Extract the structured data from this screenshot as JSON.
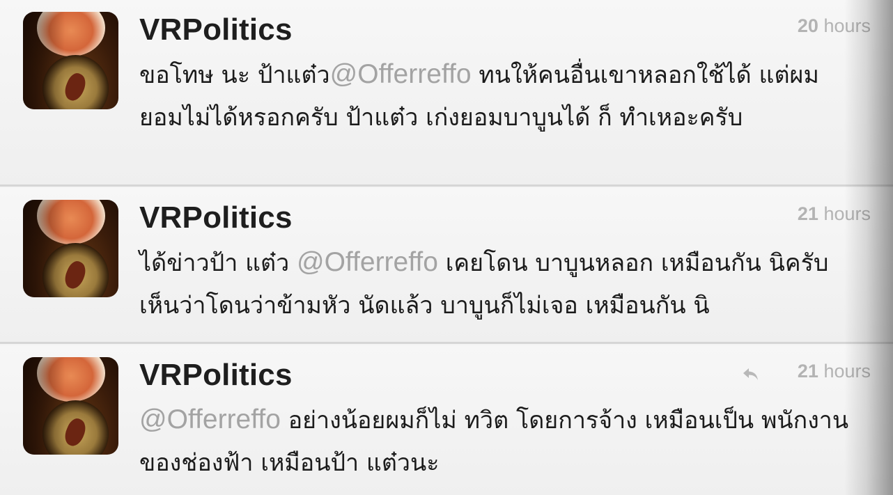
{
  "tweets": [
    {
      "username": "VRPolitics",
      "time_number": "20",
      "time_unit": "hours",
      "has_reply_icon": false,
      "text_before": "ขอโทษ นะ ป้าแต๋ว",
      "mention": "@Offerreffo",
      "text_after": "  ทนให้คนอื่นเขาหลอกใช้ได้ แต่ผม ยอมไม่ได้หรอกครับ ป้าแต๋ว เก่งยอมบาบูนได้ ก็  ทำเหอะครับ"
    },
    {
      "username": "VRPolitics",
      "time_number": "21",
      "time_unit": "hours",
      "has_reply_icon": false,
      "text_before": "ได้ข่าวป้า แต๋ว ",
      "mention": "@Offerreffo",
      "text_after": " เคยโดน บาบูนหลอก เหมือนกัน นิครับ เห็นว่าโดนว่าข้ามหัว นัดแล้ว บาบูนก็ไม่เจอ เหมือนกัน นิ"
    },
    {
      "username": "VRPolitics",
      "time_number": "21",
      "time_unit": "hours",
      "has_reply_icon": true,
      "text_before": "",
      "mention": "@Offerreffo",
      "text_after": " อย่างน้อยผมก็ไม่ ทวิต โดยการจ้าง เหมือนเป็น พนักงาน ของช่องฟ้า เหมือนป้า แต๋วนะ"
    }
  ],
  "colors": {
    "username": "#1e1e1e",
    "mention": "#a3a3a3",
    "timestamp": "#b3b3b3",
    "divider": "#d6d6d6"
  },
  "icons": {
    "reply": "reply-arrow-icon"
  }
}
